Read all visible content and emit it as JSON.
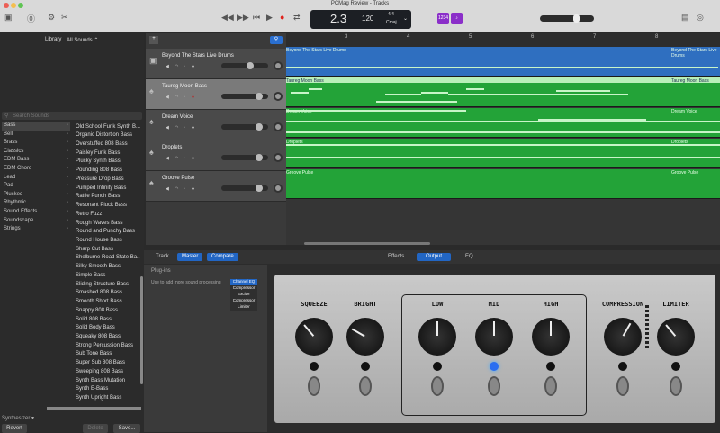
{
  "window": {
    "title": "PCMag Review - Tracks"
  },
  "lcd": {
    "position": "2.3",
    "tempo": "120",
    "time_signature": "4/4",
    "key": "Cmaj"
  },
  "badges": {
    "count_in": "1234",
    "tuner": "♪"
  },
  "library": {
    "title": "Library",
    "filter": "All Sounds ⌃",
    "search_placeholder": "Search Sounds",
    "categories": [
      "Bass",
      "Bell",
      "Brass",
      "Classics",
      "EDM Bass",
      "EDM Chord",
      "Lead",
      "Pad",
      "Plucked",
      "Rhythmic",
      "Sound Effects",
      "Soundscape",
      "Strings"
    ],
    "sounds": [
      "Old School Funk Synth B...",
      "Organic Distortion Bass",
      "Overstuffed 808 Bass",
      "Paisley Funk Bass",
      "Plucky Synth Bass",
      "Pounding 808 Bass",
      "Pressure Drop Bass",
      "Pumped Infinity Bass",
      "Rattle Punch Bass",
      "Resonant Pluck Bass",
      "Retro Fuzz",
      "Rough Waves Bass",
      "Round and Punchy Bass",
      "Round House Bass",
      "Sharp Cut Bass",
      "Shelburne Road State Ba...",
      "Silky Smooth Bass",
      "Simple Bass",
      "Sliding Structure Bass",
      "Smashed 808 Bass",
      "Smooth Short Bass",
      "Snappy 808 Bass",
      "Solid 808 Bass",
      "Solid Body Bass",
      "Squeaky 808 Bass",
      "Strong Percussion Bass",
      "Sub Tone Bass",
      "Super Sub 808 Bass",
      "Sweeping 808 Bass",
      "Synth Bass Mutation",
      "Synth E-Bass",
      "Synth Upright Bass"
    ],
    "preset_type": "Synthesizer ▾",
    "revert": "Revert",
    "delete": "Delete",
    "save": "Save..."
  },
  "tracks": [
    {
      "name": "Beyond The Stars Live Drums",
      "region": "Beyond The Stars Live Drums",
      "color": "#2f6fc0"
    },
    {
      "name": "Taureg Moon Bass",
      "region": "Taureg Moon Bass",
      "color": "#23a338"
    },
    {
      "name": "Dream Voice",
      "region": "Dream Voice",
      "color": "#23a338"
    },
    {
      "name": "Droplets",
      "region": "Droplets",
      "color": "#23a338"
    },
    {
      "name": "Groove Pulse",
      "region": "Groove Pulse",
      "color": "#23a338"
    }
  ],
  "ruler": [
    "3",
    "4",
    "5",
    "6",
    "7",
    "8"
  ],
  "add_track": "+",
  "smart_controls": {
    "tabs": [
      "Track",
      "Master",
      "Compare"
    ],
    "view_tabs": [
      "Effects",
      "Output",
      "EQ"
    ],
    "plugins_title": "Plug-ins",
    "plugins_hint": "Use to add more sound processing",
    "plugins": [
      "Channel EQ",
      "Compressor",
      "Exciter",
      "Compressor",
      "Limiter"
    ],
    "knobs": [
      "SQUEEZE",
      "BRIGHT",
      "LOW",
      "MID",
      "HIGH",
      "COMPRESSION",
      "LIMITER"
    ]
  }
}
